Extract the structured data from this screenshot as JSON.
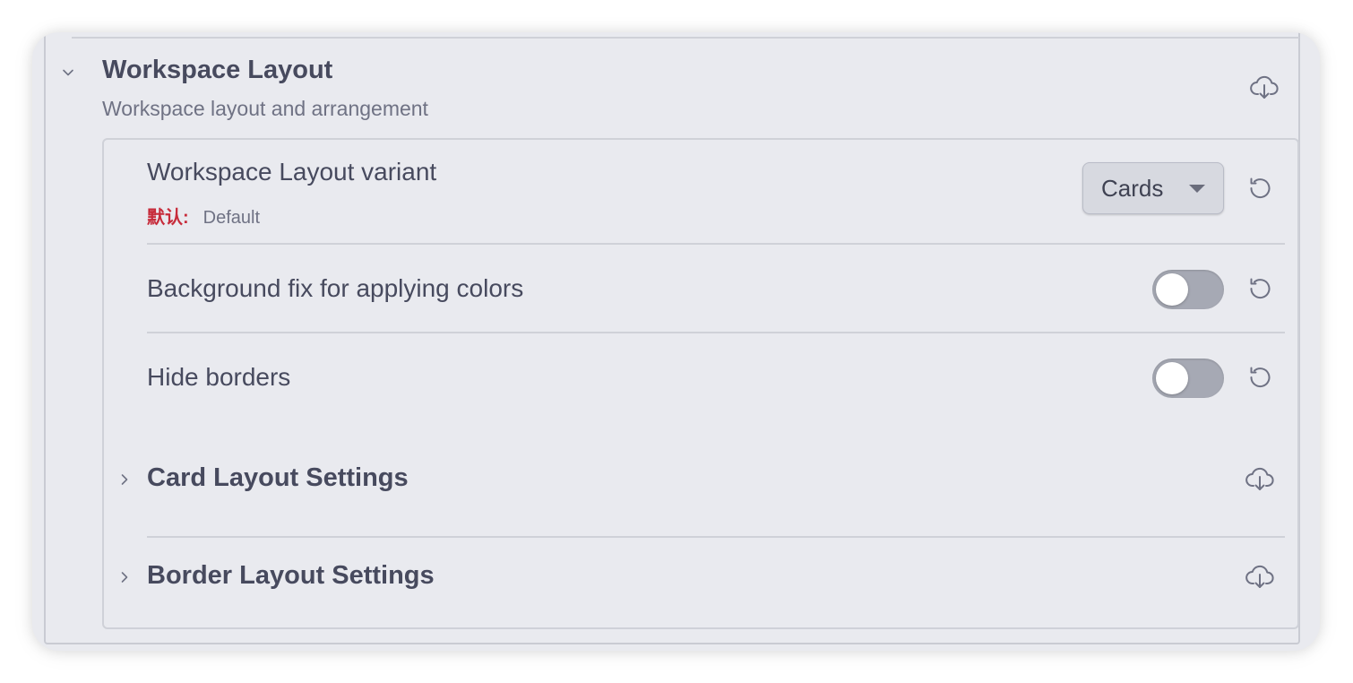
{
  "section": {
    "title": "Workspace Layout",
    "description": "Workspace layout and arrangement",
    "collapse_icon": "chevron-down-icon",
    "action_icon": "cloud-download-icon"
  },
  "settings": [
    {
      "label": "Workspace Layout variant",
      "default_label": "默认:",
      "default_value": "Default",
      "control": "dropdown",
      "selected_value": "Cards",
      "reset_icon": "reset-icon"
    },
    {
      "label": "Background fix for applying colors",
      "control": "toggle",
      "enabled": false,
      "reset_icon": "reset-icon"
    },
    {
      "label": "Hide borders",
      "control": "toggle",
      "enabled": false,
      "reset_icon": "reset-icon"
    }
  ],
  "subsections": [
    {
      "title": "Card Layout Settings",
      "expand_icon": "chevron-right-icon",
      "action_icon": "cloud-download-icon"
    },
    {
      "title": "Border Layout Settings",
      "expand_icon": "chevron-right-icon",
      "action_icon": "cloud-download-icon"
    }
  ],
  "colors": {
    "background": "#e9eaef",
    "text": "#474a5e",
    "muted_text": "#6f7284",
    "default_key": "#c72c3b",
    "toggle_off": "#a6a9b4",
    "divider": "#cfd1d8"
  }
}
